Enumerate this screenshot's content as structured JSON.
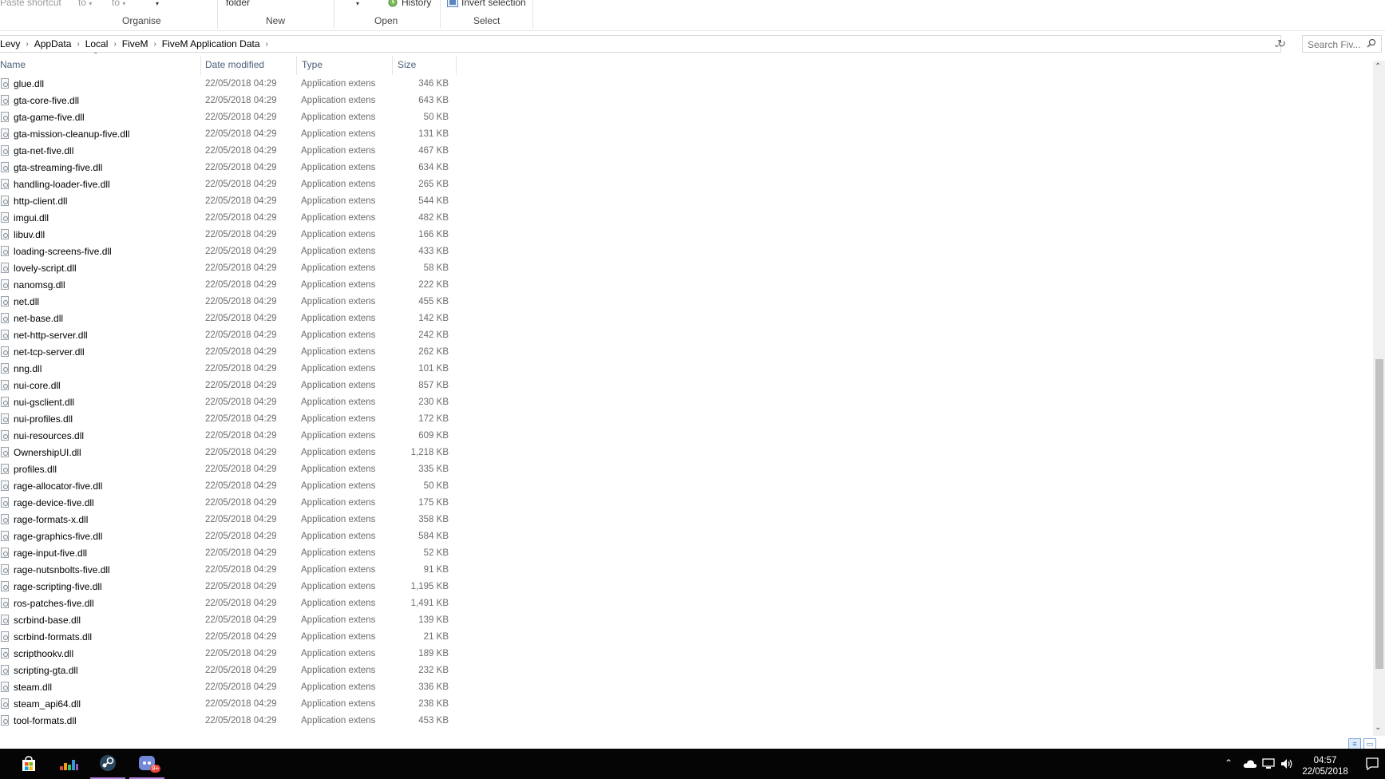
{
  "ribbon": {
    "paste_shortcut": "Paste shortcut",
    "move_to": "to",
    "copy_to": "to",
    "new_folder": "folder",
    "history": "History",
    "invert_selection": "Invert selection",
    "groups": {
      "organise": "Organise",
      "new": "New",
      "open": "Open",
      "select": "Select"
    }
  },
  "address": {
    "crumbs": [
      "Levy",
      "AppData",
      "Local",
      "FiveM",
      "FiveM Application Data"
    ],
    "search_placeholder": "Search Fiv..."
  },
  "columns": {
    "name": "Name",
    "date": "Date modified",
    "type": "Type",
    "size": "Size"
  },
  "files": [
    {
      "name": "glue.dll",
      "date": "22/05/2018 04:29",
      "type": "Application extens",
      "size": "346 KB"
    },
    {
      "name": "gta-core-five.dll",
      "date": "22/05/2018 04:29",
      "type": "Application extens",
      "size": "643 KB"
    },
    {
      "name": "gta-game-five.dll",
      "date": "22/05/2018 04:29",
      "type": "Application extens",
      "size": "50 KB"
    },
    {
      "name": "gta-mission-cleanup-five.dll",
      "date": "22/05/2018 04:29",
      "type": "Application extens",
      "size": "131 KB"
    },
    {
      "name": "gta-net-five.dll",
      "date": "22/05/2018 04:29",
      "type": "Application extens",
      "size": "467 KB"
    },
    {
      "name": "gta-streaming-five.dll",
      "date": "22/05/2018 04:29",
      "type": "Application extens",
      "size": "634 KB"
    },
    {
      "name": "handling-loader-five.dll",
      "date": "22/05/2018 04:29",
      "type": "Application extens",
      "size": "265 KB"
    },
    {
      "name": "http-client.dll",
      "date": "22/05/2018 04:29",
      "type": "Application extens",
      "size": "544 KB"
    },
    {
      "name": "imgui.dll",
      "date": "22/05/2018 04:29",
      "type": "Application extens",
      "size": "482 KB"
    },
    {
      "name": "libuv.dll",
      "date": "22/05/2018 04:29",
      "type": "Application extens",
      "size": "166 KB"
    },
    {
      "name": "loading-screens-five.dll",
      "date": "22/05/2018 04:29",
      "type": "Application extens",
      "size": "433 KB"
    },
    {
      "name": "lovely-script.dll",
      "date": "22/05/2018 04:29",
      "type": "Application extens",
      "size": "58 KB"
    },
    {
      "name": "nanomsg.dll",
      "date": "22/05/2018 04:29",
      "type": "Application extens",
      "size": "222 KB"
    },
    {
      "name": "net.dll",
      "date": "22/05/2018 04:29",
      "type": "Application extens",
      "size": "455 KB"
    },
    {
      "name": "net-base.dll",
      "date": "22/05/2018 04:29",
      "type": "Application extens",
      "size": "142 KB"
    },
    {
      "name": "net-http-server.dll",
      "date": "22/05/2018 04:29",
      "type": "Application extens",
      "size": "242 KB"
    },
    {
      "name": "net-tcp-server.dll",
      "date": "22/05/2018 04:29",
      "type": "Application extens",
      "size": "262 KB"
    },
    {
      "name": "nng.dll",
      "date": "22/05/2018 04:29",
      "type": "Application extens",
      "size": "101 KB"
    },
    {
      "name": "nui-core.dll",
      "date": "22/05/2018 04:29",
      "type": "Application extens",
      "size": "857 KB"
    },
    {
      "name": "nui-gsclient.dll",
      "date": "22/05/2018 04:29",
      "type": "Application extens",
      "size": "230 KB"
    },
    {
      "name": "nui-profiles.dll",
      "date": "22/05/2018 04:29",
      "type": "Application extens",
      "size": "172 KB"
    },
    {
      "name": "nui-resources.dll",
      "date": "22/05/2018 04:29",
      "type": "Application extens",
      "size": "609 KB"
    },
    {
      "name": "OwnershipUI.dll",
      "date": "22/05/2018 04:29",
      "type": "Application extens",
      "size": "1,218 KB"
    },
    {
      "name": "profiles.dll",
      "date": "22/05/2018 04:29",
      "type": "Application extens",
      "size": "335 KB"
    },
    {
      "name": "rage-allocator-five.dll",
      "date": "22/05/2018 04:29",
      "type": "Application extens",
      "size": "50 KB"
    },
    {
      "name": "rage-device-five.dll",
      "date": "22/05/2018 04:29",
      "type": "Application extens",
      "size": "175 KB"
    },
    {
      "name": "rage-formats-x.dll",
      "date": "22/05/2018 04:29",
      "type": "Application extens",
      "size": "358 KB"
    },
    {
      "name": "rage-graphics-five.dll",
      "date": "22/05/2018 04:29",
      "type": "Application extens",
      "size": "584 KB"
    },
    {
      "name": "rage-input-five.dll",
      "date": "22/05/2018 04:29",
      "type": "Application extens",
      "size": "52 KB"
    },
    {
      "name": "rage-nutsnbolts-five.dll",
      "date": "22/05/2018 04:29",
      "type": "Application extens",
      "size": "91 KB"
    },
    {
      "name": "rage-scripting-five.dll",
      "date": "22/05/2018 04:29",
      "type": "Application extens",
      "size": "1,195 KB"
    },
    {
      "name": "ros-patches-five.dll",
      "date": "22/05/2018 04:29",
      "type": "Application extens",
      "size": "1,491 KB"
    },
    {
      "name": "scrbind-base.dll",
      "date": "22/05/2018 04:29",
      "type": "Application extens",
      "size": "139 KB"
    },
    {
      "name": "scrbind-formats.dll",
      "date": "22/05/2018 04:29",
      "type": "Application extens",
      "size": "21 KB"
    },
    {
      "name": "scripthookv.dll",
      "date": "22/05/2018 04:29",
      "type": "Application extens",
      "size": "189 KB"
    },
    {
      "name": "scripting-gta.dll",
      "date": "22/05/2018 04:29",
      "type": "Application extens",
      "size": "232 KB"
    },
    {
      "name": "steam.dll",
      "date": "22/05/2018 04:29",
      "type": "Application extens",
      "size": "336 KB"
    },
    {
      "name": "steam_api64.dll",
      "date": "22/05/2018 04:29",
      "type": "Application extens",
      "size": "238 KB"
    },
    {
      "name": "tool-formats.dll",
      "date": "22/05/2018 04:29",
      "type": "Application extens",
      "size": "453 KB"
    }
  ],
  "taskbar": {
    "discord_badge": "9+",
    "time": "04:57",
    "date": "22/05/2018"
  },
  "colors": {
    "accent": "#b882e6",
    "header_text": "#4c607a",
    "taskbar": "#050505"
  }
}
